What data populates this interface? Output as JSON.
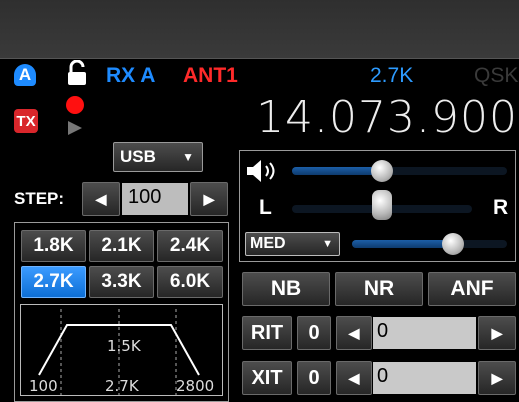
{
  "status": {
    "rx_label": "RX A",
    "antenna": "ANT1",
    "bandwidth": "2.7K",
    "qsk": "QSK",
    "tx_badge": "TX",
    "a_badge": "A"
  },
  "frequency": "14.073.900",
  "mode": {
    "selected": "USB"
  },
  "step": {
    "label": "STEP:",
    "value": "100"
  },
  "filters": {
    "buttons": [
      "1.8K",
      "2.1K",
      "2.4K",
      "2.7K",
      "3.3K",
      "6.0K"
    ],
    "selected": "2.7K",
    "graph": {
      "center_label": "1.5K",
      "low": "100",
      "width": "2.7K",
      "high": "2800"
    }
  },
  "audio": {
    "volume_level": 0.42,
    "balance_left": "L",
    "balance_right": "R",
    "balance_level": 0.5,
    "agc_mode": "MED",
    "agc_level": 0.65
  },
  "dsp": {
    "nb": "NB",
    "nr": "NR",
    "anf": "ANF"
  },
  "rit": {
    "label": "RIT",
    "toggle": "0",
    "value": "0"
  },
  "xit": {
    "label": "XIT",
    "toggle": "0",
    "value": "0"
  },
  "colors": {
    "accent_blue": "#1e8bff",
    "antenna_red": "#ff2a2a",
    "tx_red": "#d9262b"
  }
}
